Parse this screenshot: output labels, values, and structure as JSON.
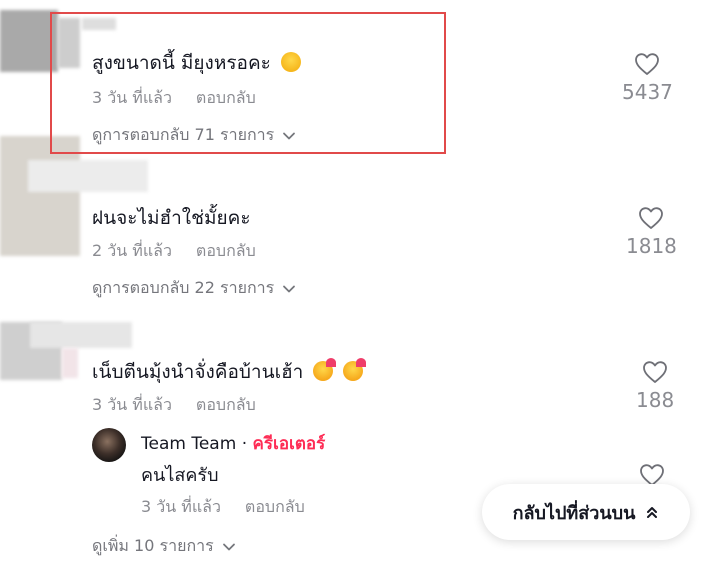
{
  "comments": [
    {
      "text": "สูงขนาดนี้ มียุงหรอคะ",
      "emoji": "laughing-emoji",
      "time": "3 วัน ที่แล้ว",
      "reply": "ตอบกลับ",
      "view_replies": "ดูการตอบกลับ 71 รายการ",
      "likes": "5437"
    },
    {
      "text": "ฝนจะไม่ฮำใช่มั้ยคะ",
      "time": "2 วัน ที่แล้ว",
      "reply": "ตอบกลับ",
      "view_replies": "ดูการตอบกลับ 22 รายการ",
      "likes": "1818"
    },
    {
      "text": "เน็บตีนมุ้งนำจั่งคือบ้านเฮ้า",
      "emoji": "heart-face-emoji",
      "time": "3 วัน ที่แล้ว",
      "reply": "ตอบกลับ",
      "likes": "188"
    }
  ],
  "creator_reply": {
    "author": "Team Team",
    "separator": "·",
    "badge": "ครีเอเตอร์",
    "text": "คนไสครับ",
    "time": "3 วัน ที่แล้ว",
    "reply": "ตอบกลับ"
  },
  "view_more": "ดูเพิ่ม 10 รายการ",
  "back_to_top": "กลับไปที่ส่วนบน",
  "colors": {
    "highlight": "#e14a4a",
    "creator": "#fe2c55",
    "muted": "#8a8b91"
  }
}
